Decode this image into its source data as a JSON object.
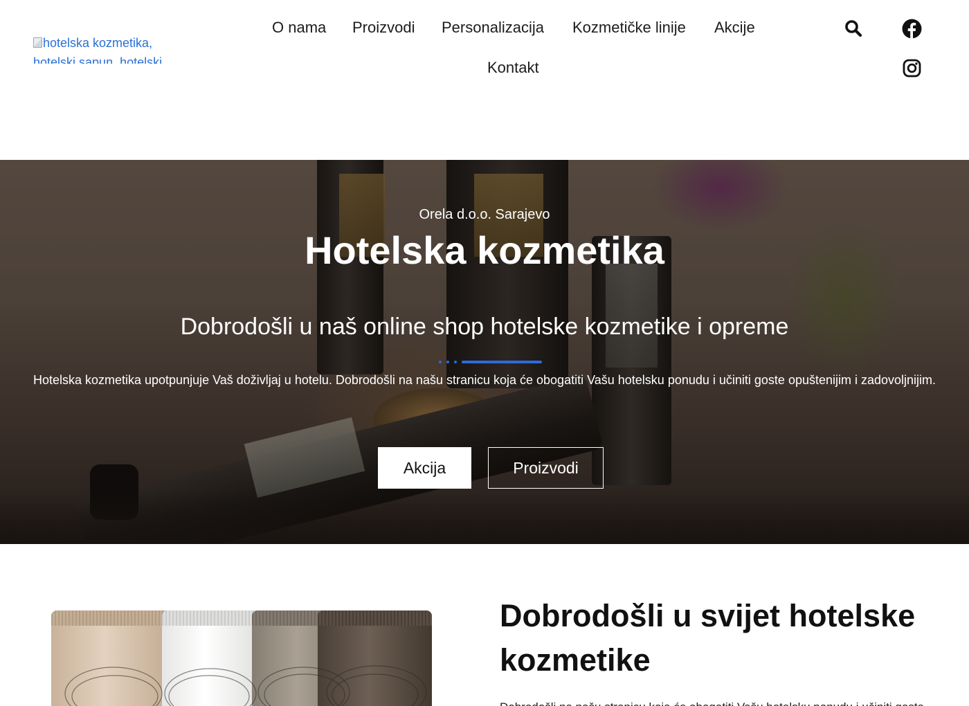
{
  "header": {
    "logo_alt": "hotelska kozmetika, hotelski sapun, hotelski",
    "nav": [
      {
        "label": "O nama"
      },
      {
        "label": "Proizvodi"
      },
      {
        "label": "Personalizacija"
      },
      {
        "label": "Kozmetičke linije"
      },
      {
        "label": "Akcije"
      },
      {
        "label": "Kontakt"
      }
    ],
    "icons": {
      "search": "search-icon",
      "facebook": "facebook-icon",
      "instagram": "instagram-icon"
    }
  },
  "hero": {
    "eyebrow": "Orela d.o.o. Sarajevo",
    "title": "Hotelska kozmetika",
    "subtitle": "Dobrodošli u naš online shop hotelske kozmetike i opreme",
    "description": "Hotelska kozmetika upotpunjuje Vaš doživljaj u hotelu. Dobrodošli na našu stranicu koja će obogatiti Vašu hotelsku ponudu i učiniti goste opuštenijim i zadovoljnijim.",
    "buttons": {
      "primary": "Akcija",
      "secondary": "Proizvodi"
    }
  },
  "intro": {
    "title": "Dobrodošli u svijet hotelske kozmetike",
    "text": "Dobrodošli na našu stranicu koja će obogatiti Vašu hotelsku ponudu i učiniti goste"
  },
  "colors": {
    "accent": "#2c6bdc",
    "link": "#2a6fd6"
  }
}
